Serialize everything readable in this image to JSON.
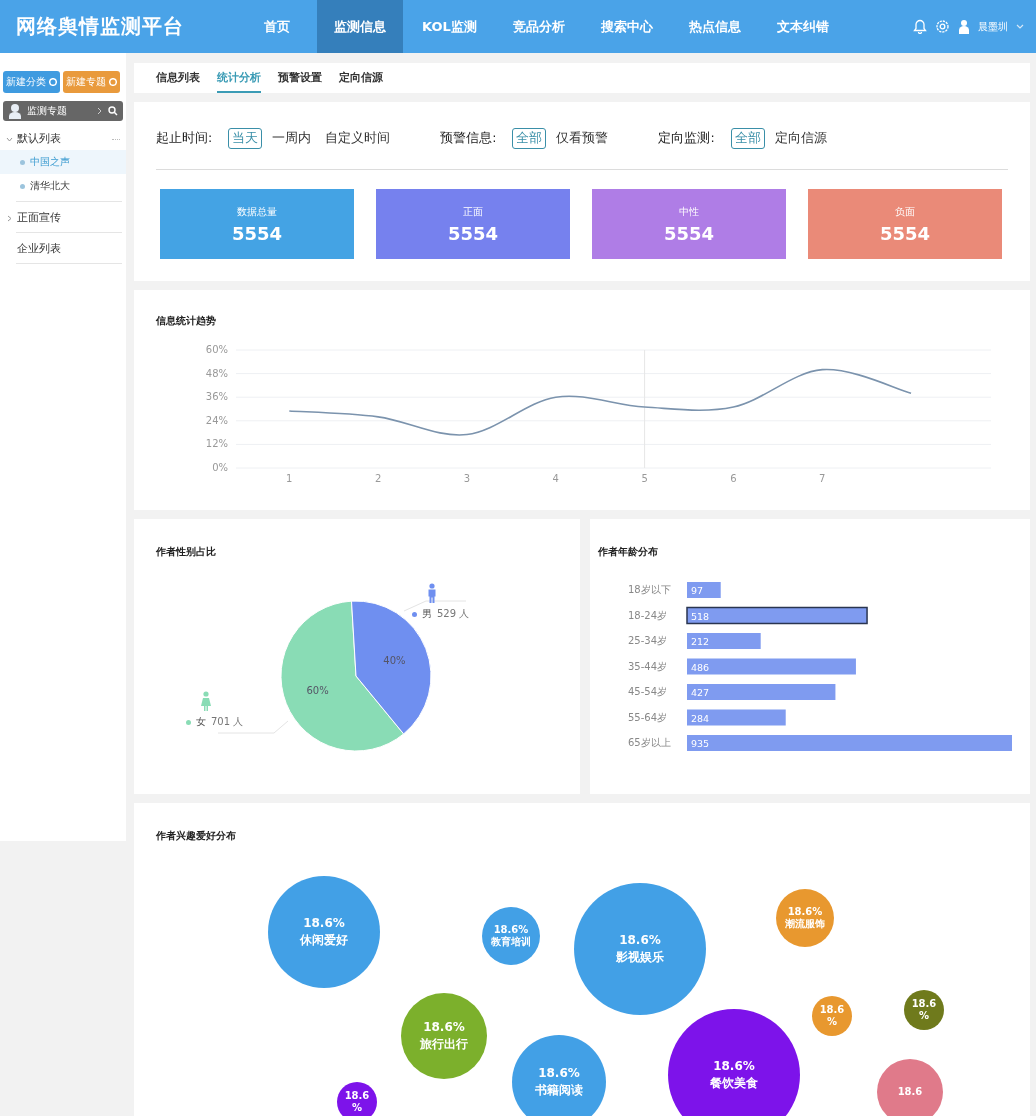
{
  "header": {
    "title": "网络舆情监测平台",
    "nav": [
      {
        "label": "首页",
        "selected": false
      },
      {
        "label": "监测信息",
        "selected": true
      },
      {
        "label": "KOL监测",
        "selected": false
      },
      {
        "label": "竞品分析",
        "selected": false
      },
      {
        "label": "搜索中心",
        "selected": false
      },
      {
        "label": "热点信息",
        "selected": false
      },
      {
        "label": "文本纠错",
        "selected": false
      }
    ],
    "user": "晨墨圳"
  },
  "sidebar": {
    "buttons": [
      {
        "label": "新建分类",
        "kind": "primary"
      },
      {
        "label": "新建专题",
        "kind": "warning"
      }
    ],
    "panel_title": "监测专题",
    "tree": [
      {
        "label": "默认列表",
        "expanded": true,
        "children": [
          {
            "label": "中国之声",
            "selected": true
          },
          {
            "label": "清华北大",
            "selected": false
          }
        ]
      },
      {
        "label": "正面宣传",
        "expanded": false
      },
      {
        "label": "企业列表"
      }
    ]
  },
  "tabs": [
    {
      "label": "信息列表",
      "selected": false
    },
    {
      "label": "统计分析",
      "selected": true
    },
    {
      "label": "预警设置",
      "selected": false
    },
    {
      "label": "定向信源",
      "selected": false
    }
  ],
  "filters": [
    {
      "label": "起止时间:",
      "options": [
        {
          "label": "当天",
          "selected": true
        },
        {
          "label": "一周内",
          "selected": false
        },
        {
          "label": "自定义时间",
          "selected": false
        }
      ]
    },
    {
      "label": "预警信息:",
      "options": [
        {
          "label": "全部",
          "selected": true
        },
        {
          "label": "仅看预警",
          "selected": false
        }
      ]
    },
    {
      "label": "定向监测:",
      "options": [
        {
          "label": "全部",
          "selected": true
        },
        {
          "label": "定向信源",
          "selected": false
        }
      ]
    }
  ],
  "stats": [
    {
      "label": "数据总量",
      "value": "5554",
      "color": "#44a3e4"
    },
    {
      "label": "正面",
      "value": "5554",
      "color": "#7681ee"
    },
    {
      "label": "中性",
      "value": "5554",
      "color": "#af7de6"
    },
    {
      "label": "负面",
      "value": "5554",
      "color": "#ea8a78"
    }
  ],
  "trend": {
    "title": "信息统计趋势",
    "chart_data": {
      "type": "line",
      "x": [
        1,
        2,
        3,
        4,
        5,
        6,
        7,
        8
      ],
      "xlim": [
        0.4,
        8.9
      ],
      "xticks": [
        1,
        2,
        3,
        4,
        5,
        6,
        7
      ],
      "ylim": [
        0,
        60
      ],
      "grid": true,
      "ref_lines": [
        {
          "axis": "x",
          "value": 5
        }
      ],
      "yticks": [
        {
          "value": 0,
          "label": "0%"
        },
        {
          "value": 12,
          "label": "12%"
        },
        {
          "value": 24,
          "label": "24%"
        },
        {
          "value": 36,
          "label": "36%"
        },
        {
          "value": 48,
          "label": "48%"
        },
        {
          "value": 60,
          "label": "60%"
        }
      ],
      "series": [
        {
          "color": "#7b93ad",
          "values": [
            29,
            26,
            17,
            36,
            31,
            31,
            50,
            38
          ]
        }
      ]
    }
  },
  "gender": {
    "title": "作者性别占比",
    "chart_data": {
      "type": "pie",
      "categories": [
        "女",
        "男"
      ],
      "values": [
        60,
        40
      ],
      "value_labels": [
        "60%",
        "40%"
      ],
      "legend": "upper left"
    },
    "legend": [
      {
        "count": "701 人",
        "color": "#89dcb5"
      },
      {
        "count": "529 人",
        "color": "#6f8ff0"
      }
    ]
  },
  "age": {
    "title": "作者年龄分布",
    "chart_data": {
      "type": "bar",
      "orientation": "horizontal",
      "categories": [
        "18岁以下",
        "18-24岁",
        "25-34岁",
        "35-44岁",
        "45-54岁",
        "55-64岁",
        "65岁以上"
      ],
      "series": [
        {
          "color": "#7f9bf0",
          "values": [
            97,
            518,
            212,
            486,
            427,
            284,
            935
          ]
        }
      ],
      "data_labels": true
    },
    "bars": [
      {
        "outlined": false
      },
      {
        "outlined": true
      },
      {
        "outlined": false
      },
      {
        "outlined": false
      },
      {
        "outlined": false
      },
      {
        "outlined": false
      },
      {
        "outlined": false
      }
    ]
  },
  "interests": {
    "title": "作者兴趣爱好分布",
    "bubbles": [
      {
        "lines": [
          "18.6%",
          "休闲爱好"
        ],
        "color": "#42a0e6"
      },
      {
        "lines": [
          "18.6%",
          "教育培训"
        ],
        "color": "#42a0e6"
      },
      {
        "lines": [
          "18.6%",
          "影视娱乐"
        ],
        "color": "#42a0e6"
      },
      {
        "lines": [
          "18.6%",
          "潮流服饰"
        ],
        "color": "#e8982f"
      },
      {
        "lines": [
          "18.6%",
          "旅行出行"
        ],
        "color": "#7cb02c"
      },
      {
        "lines": [
          "18.6%",
          "书籍阅读"
        ],
        "color": "#42a0e6"
      },
      {
        "lines": [
          "18.6%",
          "餐饮美食"
        ],
        "color": "#7d13ea"
      },
      {
        "lines": [
          "18.6",
          "%"
        ],
        "color": "#e8982f"
      },
      {
        "lines": [
          "18.6",
          "%"
        ],
        "color": "#6f7a1c"
      },
      {
        "lines": [
          "18.6"
        ],
        "color": "#e07a8a"
      },
      {
        "lines": [
          "18.6",
          "%"
        ],
        "color": "#7d13ea"
      }
    ]
  }
}
